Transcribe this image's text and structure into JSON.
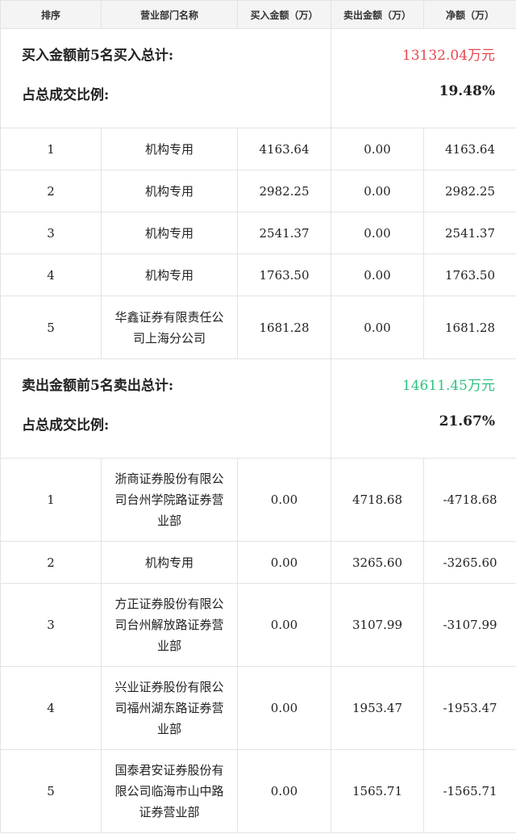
{
  "header": [
    "排序",
    "营业部门名称",
    "买入金额（万）",
    "卖出金额（万）",
    "净额（万）"
  ],
  "buy_section": {
    "total_label": "买入金额前5名买入总计:",
    "total_value": "13132.04万元",
    "ratio_label": "占总成交比例:",
    "ratio_value": "19.48%",
    "rows": [
      {
        "rank": "1",
        "name": "机构专用",
        "buy": "4163.64",
        "sell": "0.00",
        "net": "4163.64"
      },
      {
        "rank": "2",
        "name": "机构专用",
        "buy": "2982.25",
        "sell": "0.00",
        "net": "2982.25"
      },
      {
        "rank": "3",
        "name": "机构专用",
        "buy": "2541.37",
        "sell": "0.00",
        "net": "2541.37"
      },
      {
        "rank": "4",
        "name": "机构专用",
        "buy": "1763.50",
        "sell": "0.00",
        "net": "1763.50"
      },
      {
        "rank": "5",
        "name": "华鑫证券有限责任公司上海分公司",
        "buy": "1681.28",
        "sell": "0.00",
        "net": "1681.28"
      }
    ]
  },
  "sell_section": {
    "total_label": "卖出金额前5名卖出总计:",
    "total_value": "14611.45万元",
    "ratio_label": "占总成交比例:",
    "ratio_value": "21.67%",
    "rows": [
      {
        "rank": "1",
        "name": "浙商证券股份有限公司台州学院路证券营业部",
        "buy": "0.00",
        "sell": "4718.68",
        "net": "-4718.68"
      },
      {
        "rank": "2",
        "name": "机构专用",
        "buy": "0.00",
        "sell": "3265.60",
        "net": "-3265.60"
      },
      {
        "rank": "3",
        "name": "方正证券股份有限公司台州解放路证券营业部",
        "buy": "0.00",
        "sell": "3107.99",
        "net": "-3107.99"
      },
      {
        "rank": "4",
        "name": "兴业证券股份有限公司福州湖东路证券营业部",
        "buy": "0.00",
        "sell": "1953.47",
        "net": "-1953.47"
      },
      {
        "rank": "5",
        "name": "国泰君安证券股份有限公司临海市山中路证券营业部",
        "buy": "0.00",
        "sell": "1565.71",
        "net": "-1565.71"
      }
    ]
  },
  "colors": {
    "buy_total": "#e8474d",
    "sell_total": "#2ec27e"
  }
}
